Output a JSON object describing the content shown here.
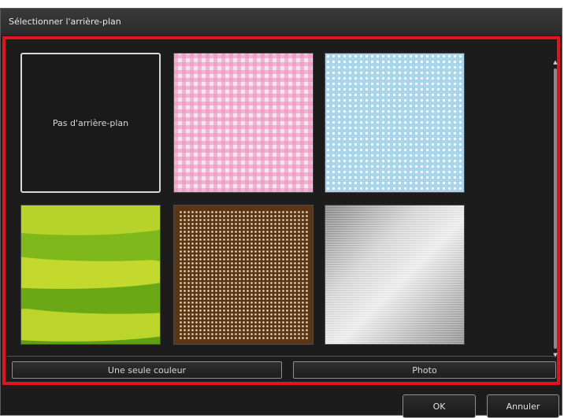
{
  "dialog": {
    "title": "Sélectionner l'arrière-plan"
  },
  "tiles": [
    {
      "label": "Pas d'arrière-plan",
      "kind": "none",
      "selected": true
    },
    {
      "label": "",
      "kind": "pink-gingham"
    },
    {
      "label": "",
      "kind": "blue-polka-dots"
    },
    {
      "label": "",
      "kind": "green-waves"
    },
    {
      "label": "",
      "kind": "brown-dots"
    },
    {
      "label": "",
      "kind": "brushed-silver"
    }
  ],
  "options": {
    "single_color_label": "Une seule couleur",
    "photo_label": "Photo"
  },
  "footer": {
    "ok_label": "OK",
    "cancel_label": "Annuler"
  },
  "colors": {
    "highlight_border": "#e0141e",
    "dialog_bg": "#1c1c1c"
  }
}
